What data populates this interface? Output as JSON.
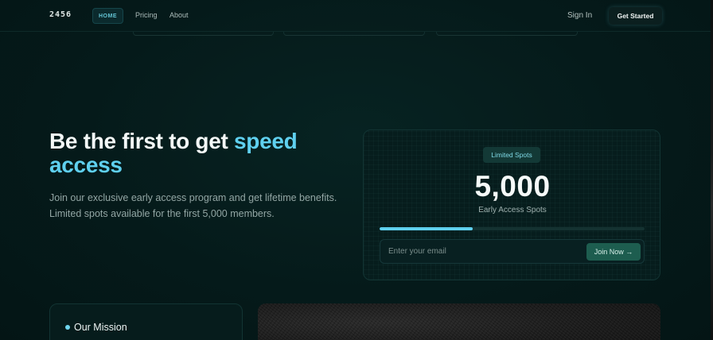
{
  "nav": {
    "logo": "2456",
    "home": "HOME",
    "links": [
      "Pricing",
      "About"
    ],
    "sign_in": "Sign In",
    "get_started": "Get Started"
  },
  "hero": {
    "title_plain": "Be the first to get ",
    "title_accent": "speed access",
    "subtitle_line1": "Join our exclusive early access program and get lifetime benefits.",
    "subtitle_line2": "Limited spots available for the first 5,000 members."
  },
  "signup_card": {
    "badge": "Limited Spots",
    "count": "5,000",
    "count_label": "Early Access Spots",
    "progress_fraction": 0.35,
    "email_placeholder": "Enter your email",
    "join_label": "Join Now →"
  },
  "mission": {
    "title": "Our Mission"
  },
  "colors": {
    "background": "#041616",
    "accent": "#5fd0ef",
    "join_button": "#1d5d4f",
    "badge_bg": "#133936"
  }
}
